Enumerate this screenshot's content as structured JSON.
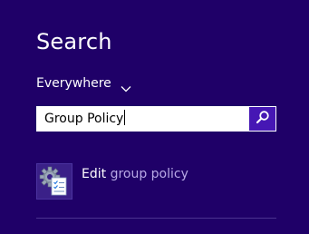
{
  "pane": {
    "title": "Search"
  },
  "scope": {
    "label": "Everywhere",
    "icon": "chevron-down-icon"
  },
  "search": {
    "value": "Group Policy",
    "button_icon": "search-icon"
  },
  "results": [
    {
      "icon": "group-policy-icon",
      "label_prefix": "Edit ",
      "label_rest": "group policy"
    }
  ],
  "colors": {
    "background": "#1f0068",
    "search_button": "#4617b4",
    "muted_text": "#b8a9e6"
  }
}
